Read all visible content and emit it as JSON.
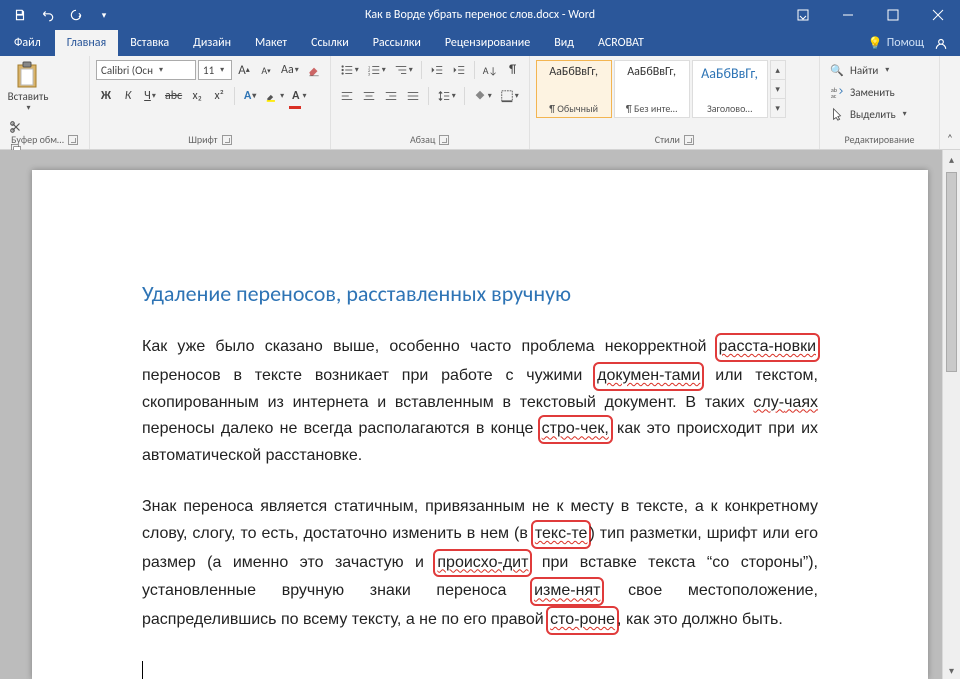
{
  "title": "Как в Ворде убрать перенос слов.docx - Word",
  "tabs": {
    "file": "Файл",
    "items": [
      "Главная",
      "Вставка",
      "Дизайн",
      "Макет",
      "Ссылки",
      "Рассылки",
      "Рецензирование",
      "Вид",
      "ACROBAT"
    ],
    "active": "Главная",
    "tellme": "Помощ"
  },
  "ribbon": {
    "clipboard": {
      "paste": "Вставить",
      "group_label": "Буфер обм…"
    },
    "font": {
      "name": "Calibri (Осн",
      "size": "11",
      "grow": "A",
      "shrink": "A",
      "case": "Aa",
      "clear": "⌫",
      "bold": "Ж",
      "italic": "К",
      "underline": "Ч",
      "strike": "abc",
      "sub": "x₂",
      "sup": "x²",
      "group_label": "Шрифт"
    },
    "paragraph": {
      "group_label": "Абзац"
    },
    "styles": {
      "preview": "АаБбВвГг,",
      "items": [
        "¶ Обычный",
        "¶ Без инте…",
        "Заголово…"
      ],
      "group_label": "Стили"
    },
    "editing": {
      "find": "Найти",
      "replace": "Заменить",
      "select": "Выделить",
      "group_label": "Редактирование"
    }
  },
  "doc": {
    "heading": "Удаление переносов, расставленных вручную",
    "p1": {
      "t0": "Как уже было сказано выше, особенно часто проблема некорректной ",
      "w0": "расста-новки",
      "t1": " переносов в тексте возникает при работе с чужими ",
      "w1": "докумен-тами",
      "t2": " или текстом, скопированным из интернета и вставленным в текстовый документ. В таких ",
      "w2a": "слу-",
      "w2b": "чаях",
      "t3": " переносы далеко не всегда располагаются в конце ",
      "w3": "стро-чек,",
      "t4": " как это происходит при их автоматической расстановке."
    },
    "p2": {
      "t0": "Знак переноса является статичным, привязанным не к месту в тексте, а к конкретному слову, слогу, то есть, достаточно изменить в нем (в ",
      "w0": "текс-те",
      "t1": ") тип разметки, шрифт или его размер (а именно это зачастую и ",
      "w1": "происхо-дит",
      "t2": " при вставке текста “со стороны”), установленные вручную знаки переноса ",
      "w2": "изме-нят",
      "t3": " свое местоположение, распределившись по всему тексту, а не по его правой ",
      "w3": "сто-роне",
      "t4": ", как это должно быть."
    }
  }
}
